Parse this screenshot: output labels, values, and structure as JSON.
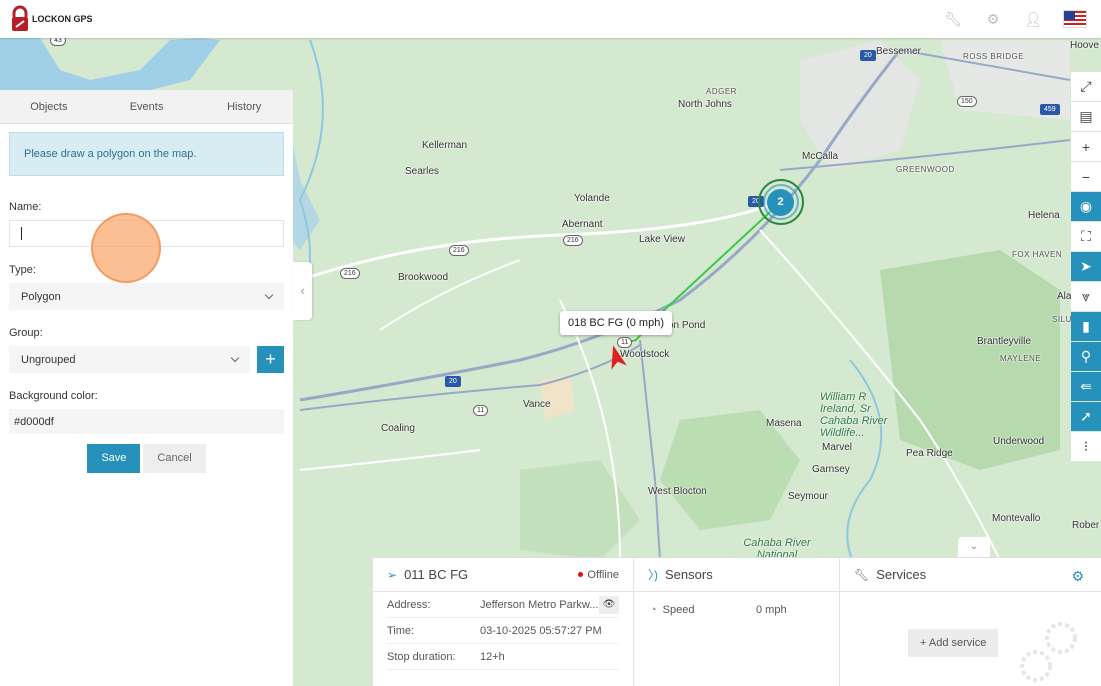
{
  "app": {
    "logo_text": "LOCKON GPS"
  },
  "header": {
    "icons": [
      "wrench-icon",
      "gear-icon",
      "user-icon",
      "us-flag-icon"
    ]
  },
  "left_panel": {
    "tabs": [
      {
        "label": "Objects"
      },
      {
        "label": "Events"
      },
      {
        "label": "History"
      }
    ],
    "info": "Please draw a polygon on the map.",
    "name_label": "Name:",
    "name_value": "",
    "type_label": "Type:",
    "type_value": "Polygon",
    "group_label": "Group:",
    "group_value": "Ungrouped",
    "add_group_label": "+",
    "bg_color_label": "Background color:",
    "bg_color_value": "#d000df",
    "save_label": "Save",
    "cancel_label": "Cancel"
  },
  "map": {
    "labels": [
      {
        "text": "Bessemer"
      },
      {
        "text": "ROSS BRIDGE"
      },
      {
        "text": "Hoove"
      },
      {
        "text": "ADGER"
      },
      {
        "text": "North Johns"
      },
      {
        "text": "Kellerman"
      },
      {
        "text": "Searles"
      },
      {
        "text": "McCalla"
      },
      {
        "text": "GREENWOOD"
      },
      {
        "text": "Yolande"
      },
      {
        "text": "Abernant"
      },
      {
        "text": "Lake View"
      },
      {
        "text": "Helena"
      },
      {
        "text": "FOX HAVEN"
      },
      {
        "text": "Brookwood"
      },
      {
        "text": "Ala"
      },
      {
        "text": "SILU"
      },
      {
        "text": "Woodstock"
      },
      {
        "text": "on Pond"
      },
      {
        "text": "Brantleyville"
      },
      {
        "text": "MAYLENE"
      },
      {
        "text": "Vance"
      },
      {
        "text": "Coaling"
      },
      {
        "text": "Masena"
      },
      {
        "text": "Marvel"
      },
      {
        "text": "Pea Ridge"
      },
      {
        "text": "Underwood"
      },
      {
        "text": "Garnsey"
      },
      {
        "text": "Seymour"
      },
      {
        "text": "West Blocton"
      },
      {
        "text": "Montevallo"
      },
      {
        "text": "Rober"
      }
    ],
    "park_label": "William R Ireland, Sr Cahaba River Wildlife...",
    "park_label_2": "Cahaba River National",
    "shields": [
      "43",
      "20",
      "150",
      "459",
      "20",
      "216",
      "216",
      "216",
      "20",
      "11",
      "11"
    ],
    "cluster_count": "2",
    "tooltip": "018 BC FG (0 mph)",
    "collapse_symbol": "‹"
  },
  "toolbar": {
    "tools": [
      {
        "name": "fullscreen-icon",
        "glyph": "⤢",
        "blue": false
      },
      {
        "name": "map-layers-icon",
        "glyph": "▤",
        "blue": false
      },
      {
        "name": "zoom-in-icon",
        "glyph": "+",
        "blue": false
      },
      {
        "name": "zoom-out-icon",
        "glyph": "−",
        "blue": false
      },
      {
        "name": "target-icon",
        "glyph": "◉",
        "blue": true
      },
      {
        "name": "fit-bounds-icon",
        "glyph": "⛶",
        "blue": false
      },
      {
        "name": "navigation-icon",
        "glyph": "➤",
        "blue": true
      },
      {
        "name": "route-icon",
        "glyph": "⩔",
        "blue": false
      },
      {
        "name": "road-icon",
        "glyph": "▮",
        "blue": true
      },
      {
        "name": "location-pin-icon",
        "glyph": "⚲",
        "blue": true
      },
      {
        "name": "history-arrow-icon",
        "glyph": "⇚",
        "blue": true
      },
      {
        "name": "direction-icon",
        "glyph": "➚",
        "blue": true
      },
      {
        "name": "traffic-light-icon",
        "glyph": "⁝",
        "blue": false
      }
    ]
  },
  "object_panel": {
    "title": "011 BC FG",
    "status": "Offline",
    "rows": [
      {
        "key": "Address:",
        "value": "Jefferson Metro Parkw..."
      },
      {
        "key": "Time:",
        "value": "03-10-2025 05:57:27 PM"
      },
      {
        "key": "Stop duration:",
        "value": "12+h"
      }
    ]
  },
  "sensors_panel": {
    "title": "Sensors",
    "rows": [
      {
        "key": "Speed",
        "value": "0 mph"
      }
    ]
  },
  "services_panel": {
    "title": "Services",
    "add_label": "Add service"
  },
  "colors": {
    "accent": "#2691bb",
    "info_bg": "#d8ecf4",
    "offline": "#dd1111",
    "track": "#3cc84b",
    "marker": "#e02020"
  }
}
